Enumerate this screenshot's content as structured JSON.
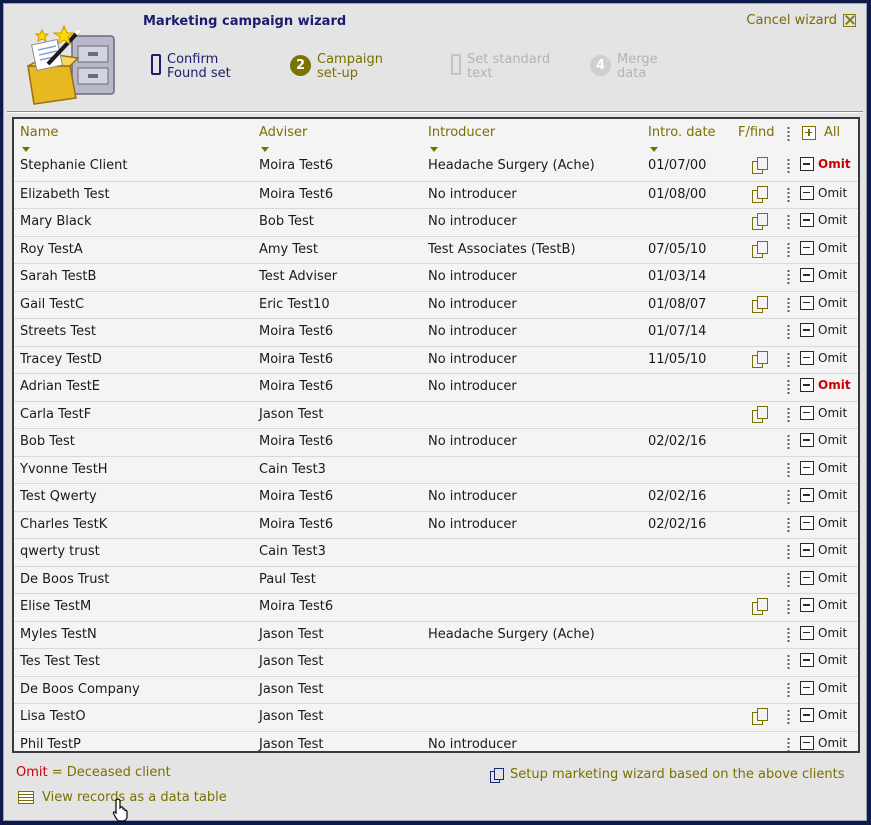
{
  "header": {
    "title": "Marketing campaign wizard",
    "cancel_label": "Cancel wizard",
    "steps": [
      {
        "num": "",
        "line1": "Confirm",
        "line2": "Found set"
      },
      {
        "num": "2",
        "line1": "Campaign",
        "line2": "set-up"
      },
      {
        "num": "",
        "line1": "Set standard",
        "line2": "text"
      },
      {
        "num": "4",
        "line1": "Merge",
        "line2": "data"
      }
    ]
  },
  "table": {
    "columns": {
      "name": "Name",
      "adviser": "Adviser",
      "introducer": "Introducer",
      "date": "Intro. date",
      "ffind": "F/find",
      "all": "All"
    },
    "omit_label": "Omit",
    "rows": [
      {
        "name": "Stephanie Client",
        "adviser": "Moira Test6",
        "introducer": "Headache Surgery (Ache)",
        "date": "01/07/00",
        "ffind": true,
        "omit": true
      },
      {
        "name": "Elizabeth Test",
        "adviser": "Moira Test6",
        "introducer": "No introducer",
        "date": "01/08/00",
        "ffind": true,
        "omit": false
      },
      {
        "name": "Mary Black",
        "adviser": "Bob Test",
        "introducer": "No introducer",
        "date": "",
        "ffind": true,
        "omit": false
      },
      {
        "name": "Roy TestA",
        "adviser": "Amy Test",
        "introducer": "Test Associates (TestB)",
        "date": "07/05/10",
        "ffind": true,
        "omit": false
      },
      {
        "name": "Sarah TestB",
        "adviser": "Test Adviser",
        "introducer": "No introducer",
        "date": "01/03/14",
        "ffind": false,
        "omit": false
      },
      {
        "name": "Gail TestC",
        "adviser": "Eric Test10",
        "introducer": "No introducer",
        "date": "01/08/07",
        "ffind": true,
        "omit": false
      },
      {
        "name": "Streets Test",
        "adviser": "Moira Test6",
        "introducer": "No introducer",
        "date": "01/07/14",
        "ffind": false,
        "omit": false
      },
      {
        "name": "Tracey TestD",
        "adviser": "Moira Test6",
        "introducer": "No introducer",
        "date": "11/05/10",
        "ffind": true,
        "omit": false
      },
      {
        "name": "Adrian TestE",
        "adviser": "Moira Test6",
        "introducer": "No introducer",
        "date": "",
        "ffind": false,
        "omit": true
      },
      {
        "name": "Carla TestF",
        "adviser": "Jason Test",
        "introducer": "",
        "date": "",
        "ffind": true,
        "omit": false
      },
      {
        "name": "Bob Test",
        "adviser": "Moira Test6",
        "introducer": "No introducer",
        "date": "02/02/16",
        "ffind": false,
        "omit": false
      },
      {
        "name": "Yvonne TestH",
        "adviser": "Cain Test3",
        "introducer": "",
        "date": "",
        "ffind": false,
        "omit": false
      },
      {
        "name": "Test Qwerty",
        "adviser": "Moira Test6",
        "introducer": "No introducer",
        "date": "02/02/16",
        "ffind": false,
        "omit": false
      },
      {
        "name": "Charles TestK",
        "adviser": "Moira Test6",
        "introducer": "No introducer",
        "date": "02/02/16",
        "ffind": false,
        "omit": false
      },
      {
        "name": "qwerty trust",
        "adviser": "Cain Test3",
        "introducer": "",
        "date": "",
        "ffind": false,
        "omit": false
      },
      {
        "name": "De Boos Trust",
        "adviser": "Paul Test",
        "introducer": "",
        "date": "",
        "ffind": false,
        "omit": false
      },
      {
        "name": "Elise TestM",
        "adviser": "Moira Test6",
        "introducer": "",
        "date": "",
        "ffind": true,
        "omit": false
      },
      {
        "name": "Myles TestN",
        "adviser": "Jason Test",
        "introducer": "Headache Surgery (Ache)",
        "date": "",
        "ffind": false,
        "omit": false
      },
      {
        "name": "Tes Test Test",
        "adviser": "Jason Test",
        "introducer": "",
        "date": "",
        "ffind": false,
        "omit": false
      },
      {
        "name": "De Boos Company",
        "adviser": "Jason Test",
        "introducer": "",
        "date": "",
        "ffind": false,
        "omit": false
      },
      {
        "name": "Lisa TestO",
        "adviser": "Jason Test",
        "introducer": "",
        "date": "",
        "ffind": true,
        "omit": false
      },
      {
        "name": "Phil TestP",
        "adviser": "Jason Test",
        "introducer": "No introducer",
        "date": "",
        "ffind": false,
        "omit": false
      }
    ]
  },
  "footer": {
    "legend_omit": "Omit",
    "legend_text": " = Deceased client",
    "setup_label": "Setup marketing wizard based on the above clients",
    "view_records_label": "View records as a data table"
  },
  "colors": {
    "accent_olive": "#7a7000",
    "title_navy": "#1c1c6e",
    "omit_red": "#cc0000",
    "background": "#e4e4e4"
  }
}
